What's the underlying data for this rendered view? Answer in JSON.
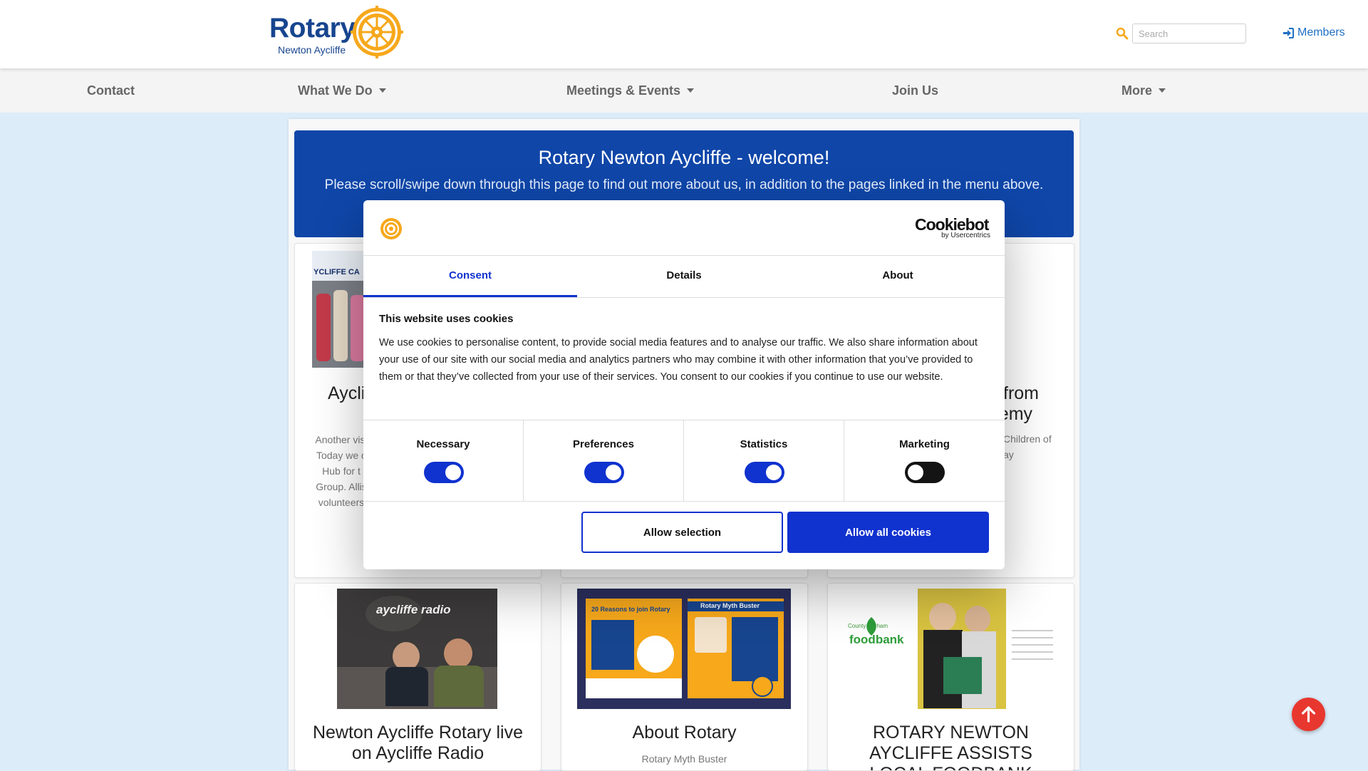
{
  "header": {
    "logo_text": "Rotary",
    "logo_subtitle": "Newton Aycliffe",
    "search_placeholder": "Search",
    "members_label": "Members"
  },
  "nav": {
    "items": [
      {
        "label": "Contact",
        "dropdown": false
      },
      {
        "label": "What We Do",
        "dropdown": true
      },
      {
        "label": "Meetings & Events",
        "dropdown": true
      },
      {
        "label": "Join Us",
        "dropdown": false
      },
      {
        "label": "More",
        "dropdown": true
      }
    ]
  },
  "hero": {
    "title": "Rotary Newton Aycliffe - welcome!",
    "subtitle": "Please scroll/swipe down through this page to find out more about us, in addition to the pages linked in the menu above."
  },
  "cards_row1": [
    {
      "title_fragment": "Aycli",
      "text_lines": [
        "Another visi",
        "Today we c",
        "Hub for t",
        "Group. Allis",
        "volunteers"
      ],
      "image_caption": "YCLIFFE CA"
    },
    {
      "title_fragment_1": "from",
      "title_fragment_2": "ademy",
      "text_fragment_1": "Children of",
      "text_fragment_2": "ay"
    }
  ],
  "cards_row2": [
    {
      "title": "Newton Aycliffe Rotary live on Aycliffe Radio",
      "image_label": "aycliffe radio"
    },
    {
      "title": "About Rotary",
      "subtitle": "Rotary Myth Buster",
      "poster_left_title": "20 Reasons to join Rotary",
      "poster_right_title": "Rotary Myth Buster"
    },
    {
      "title": "ROTARY NEWTON AYCLIFFE ASSISTS LOCAL FOODBANK",
      "image_label": "foodbank",
      "image_sublabel": "County Durham"
    }
  ],
  "cookie_dialog": {
    "brand": "Cookiebot",
    "brand_sub": "by Usercentrics",
    "tabs": [
      "Consent",
      "Details",
      "About"
    ],
    "active_tab": "Consent",
    "heading": "This website uses cookies",
    "body": "We use cookies to personalise content, to provide social media features and to analyse our traffic. We also share information about your use of our site with our social media and analytics partners who may combine it with other information that you’ve provided to them or that they’ve collected from your use of their services. You consent to our cookies if you continue to use our website.",
    "toggles": [
      {
        "label": "Necessary",
        "on": true
      },
      {
        "label": "Preferences",
        "on": true
      },
      {
        "label": "Statistics",
        "on": true
      },
      {
        "label": "Marketing",
        "on": false
      }
    ],
    "allow_selection_label": "Allow selection",
    "allow_all_label": "Allow all cookies"
  },
  "colors": {
    "rotary_blue": "#17458f",
    "rotary_gold": "#f7a81b",
    "hero_blue": "#0f46a8",
    "cookie_accent": "#1032cf",
    "scroll_top_red": "#e8372f"
  }
}
